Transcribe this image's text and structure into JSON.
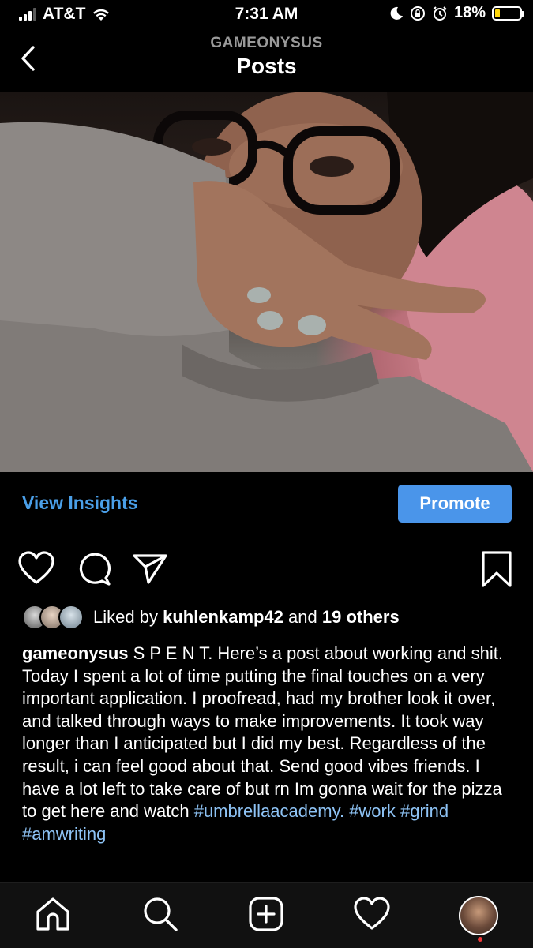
{
  "status_bar": {
    "carrier": "AT&T",
    "time": "7:31 AM",
    "battery": "18%",
    "battery_level": 0.18
  },
  "nav": {
    "subtitle": "GAMEONYSUS",
    "title": "Posts"
  },
  "insights": {
    "view_label": "View Insights",
    "promote_label": "Promote"
  },
  "likes": {
    "prefix": "Liked by",
    "user": "kuhlenkamp42",
    "middle": "and",
    "others": "19 others"
  },
  "caption": {
    "user": "gameonysus",
    "text": "S P E N T. Here’s a post about working and shit. Today I spent a lot of time putting the final touches on a very important application. I proofread, had my brother look it over, and talked through ways to make improvements. It took way longer than I anticipated but I did my best. Regardless of the result, i can feel good about that. Send good vibes friends. I have a lot left to take care of but rn Im gonna wait for the pizza to get here and watch ",
    "tags": [
      "#umbrellaacademy.",
      "#work",
      "#grind",
      "#amwriting"
    ]
  },
  "colors": {
    "link": "#4a9fe8",
    "promote": "#4a95ea",
    "hashtag": "#8ec3f5",
    "battery": "#ffd60a"
  },
  "icons": [
    "back-icon",
    "wifi-icon",
    "moon-icon",
    "lock-rotation-icon",
    "alarm-icon",
    "heart-icon",
    "comment-icon",
    "send-icon",
    "bookmark-icon",
    "home-icon",
    "search-icon",
    "add-icon",
    "activity-icon"
  ]
}
